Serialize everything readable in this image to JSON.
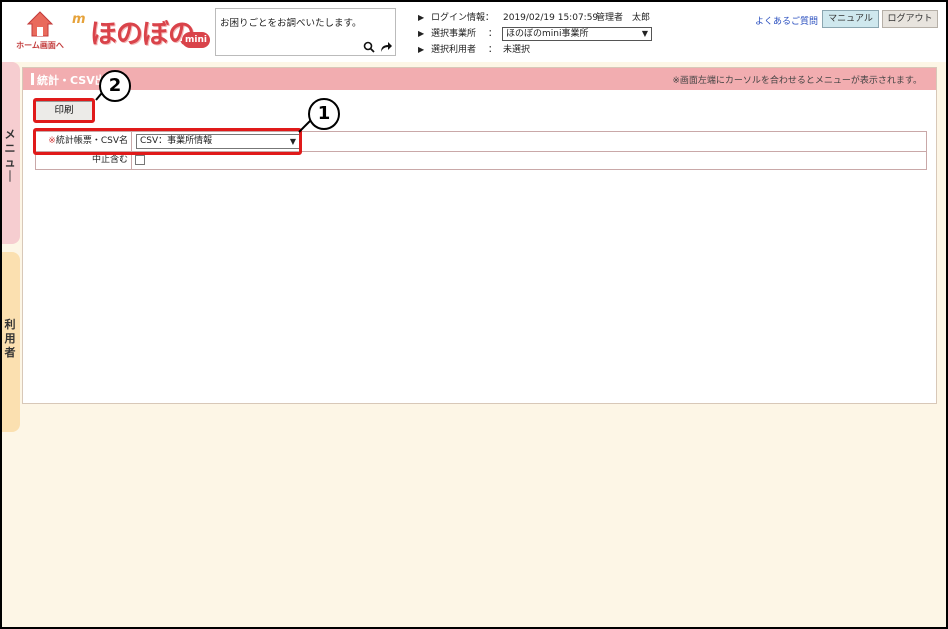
{
  "header": {
    "home_label": "ホーム画面へ",
    "logo_text": "ほのぼの",
    "logo_mini": "mini",
    "search_placeholder": "お困りごとをお調べいたします。",
    "login_label": "ログイン情報：",
    "login_datetime": "2019/02/19 15:07:59",
    "login_user": "管理者　太郎",
    "office_label": "選択事業所",
    "office_value": "ほのぼのmini事業所",
    "user_label": "選択利用者",
    "user_value": "未選択",
    "colon": "：",
    "faq_link": "よくあるご質問",
    "manual_button": "マニュアル",
    "logout_button": "ログアウト"
  },
  "sidebar": {
    "menu_tab": "メニュー",
    "user_tab": "利用者"
  },
  "panel": {
    "title": "統計・CSV出力",
    "note": "※画面左端にカーソルを合わせるとメニューが表示されます。",
    "print_button": "印刷",
    "fields": {
      "csv_required_mark": "※",
      "csv_label": "統計帳票・CSV名",
      "csv_value": "CSV：事業所情報",
      "include_stopped_label": "中止含む"
    }
  },
  "callouts": {
    "one": "1",
    "two": "2"
  },
  "colors": {
    "panel_head": "#f2adb0",
    "highlight": "#e01a1a",
    "background": "#fdf6e6"
  }
}
